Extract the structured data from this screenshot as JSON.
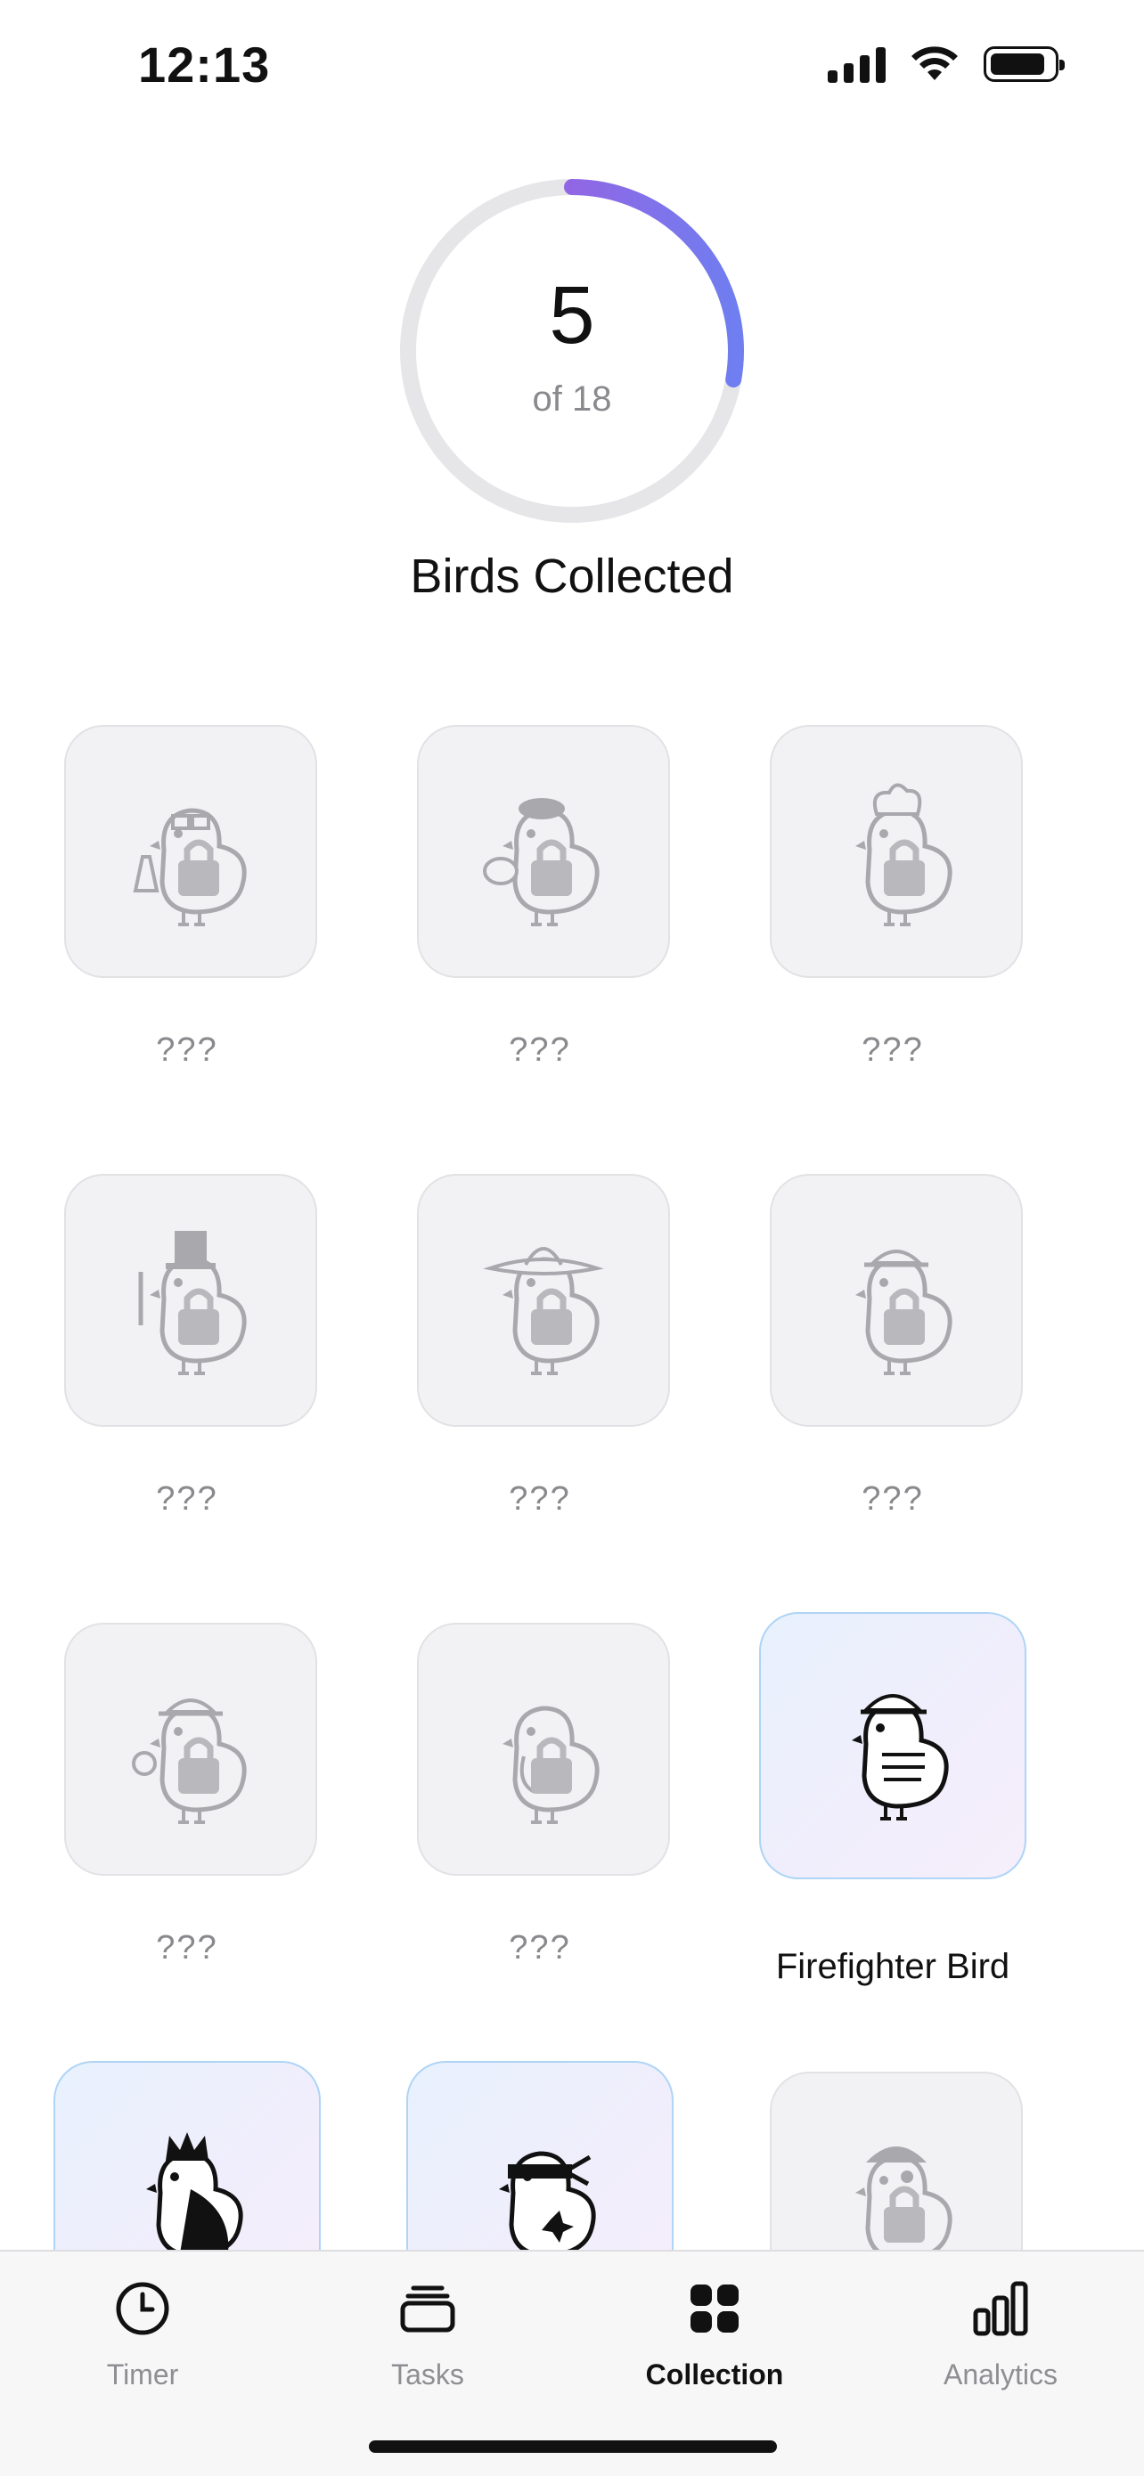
{
  "status_bar": {
    "time": "12:13"
  },
  "progress": {
    "collected": 5,
    "total": 18,
    "fraction": 0.278,
    "count_text": "5",
    "total_text": "of 18",
    "label": "Birds Collected",
    "ring_gradient": [
      "#b24fd8",
      "#6f7ef0"
    ],
    "ring_track": "#e6e6e9"
  },
  "birds": [
    {
      "label": "???",
      "locked": true,
      "icon": "scientist-bird-icon"
    },
    {
      "label": "???",
      "locked": true,
      "icon": "artist-bird-icon"
    },
    {
      "label": "???",
      "locked": true,
      "icon": "chef-bird-icon"
    },
    {
      "label": "???",
      "locked": true,
      "icon": "magician-bird-icon"
    },
    {
      "label": "???",
      "locked": true,
      "icon": "mariachi-bird-icon"
    },
    {
      "label": "???",
      "locked": true,
      "icon": "detective-hat-bird-icon"
    },
    {
      "label": "???",
      "locked": true,
      "icon": "detective-bird-icon"
    },
    {
      "label": "???",
      "locked": true,
      "icon": "doctor-bird-icon"
    },
    {
      "label": "Firefighter Bird",
      "locked": false,
      "icon": "firefighter-bird-icon"
    },
    {
      "label": "",
      "locked": false,
      "icon": "king-bird-icon"
    },
    {
      "label": "",
      "locked": false,
      "icon": "ninja-bird-icon"
    },
    {
      "label": "",
      "locked": true,
      "icon": "pirate-bird-icon"
    }
  ],
  "tabs": [
    {
      "label": "Timer",
      "icon": "clock-icon",
      "active": false
    },
    {
      "label": "Tasks",
      "icon": "stack-icon",
      "active": false
    },
    {
      "label": "Collection",
      "icon": "grid-icon",
      "active": true
    },
    {
      "label": "Analytics",
      "icon": "bar-chart-icon",
      "active": false
    }
  ],
  "colors": {
    "locked_card_bg": "#f2f2f4",
    "unlocked_card_border": "#aed4f6",
    "muted_text": "#8a8a8e"
  }
}
